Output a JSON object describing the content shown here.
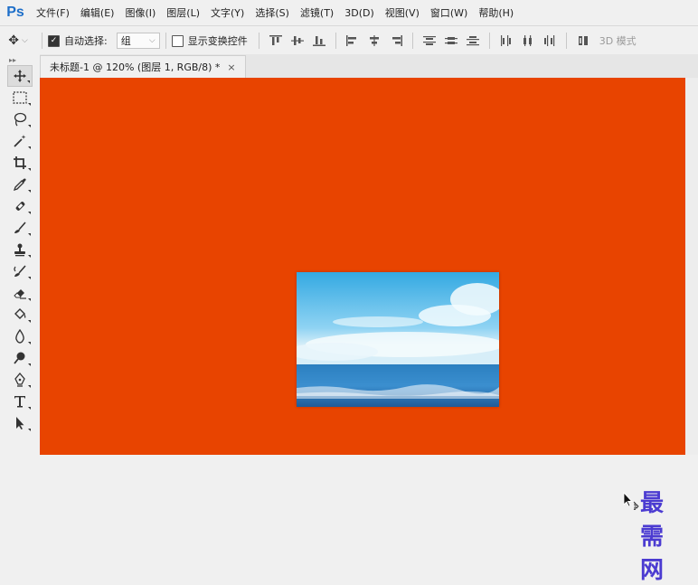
{
  "app": {
    "logo": "Ps"
  },
  "menu": [
    "文件(F)",
    "编辑(E)",
    "图像(I)",
    "图层(L)",
    "文字(Y)",
    "选择(S)",
    "滤镜(T)",
    "3D(D)",
    "视图(V)",
    "窗口(W)",
    "帮助(H)"
  ],
  "options_bar": {
    "auto_select_label": "自动选择:",
    "auto_select_checked": true,
    "auto_select_value": "组",
    "show_transform_label": "显示变换控件",
    "show_transform_checked": false,
    "mode_3d_label": "3D 模式"
  },
  "document_tab": {
    "title": "未标题-1 @ 120% (图层 1, RGB/8) *",
    "close": "×"
  },
  "tools": [
    "move-tool-icon",
    "marquee-tool-icon",
    "lasso-tool-icon",
    "magic-wand-tool-icon",
    "crop-tool-icon",
    "eyedropper-tool-icon",
    "healing-brush-tool-icon",
    "brush-tool-icon",
    "clone-stamp-tool-icon",
    "history-brush-tool-icon",
    "eraser-tool-icon",
    "paint-bucket-tool-icon",
    "blur-tool-icon",
    "dodge-tool-icon",
    "pen-tool-icon",
    "type-tool-icon",
    "path-selection-tool-icon"
  ],
  "colors": {
    "canvas_fill": "#e84400",
    "ps_blue": "#1e6fc9",
    "watermark": "#4b3bd1"
  },
  "watermark": "最需网"
}
